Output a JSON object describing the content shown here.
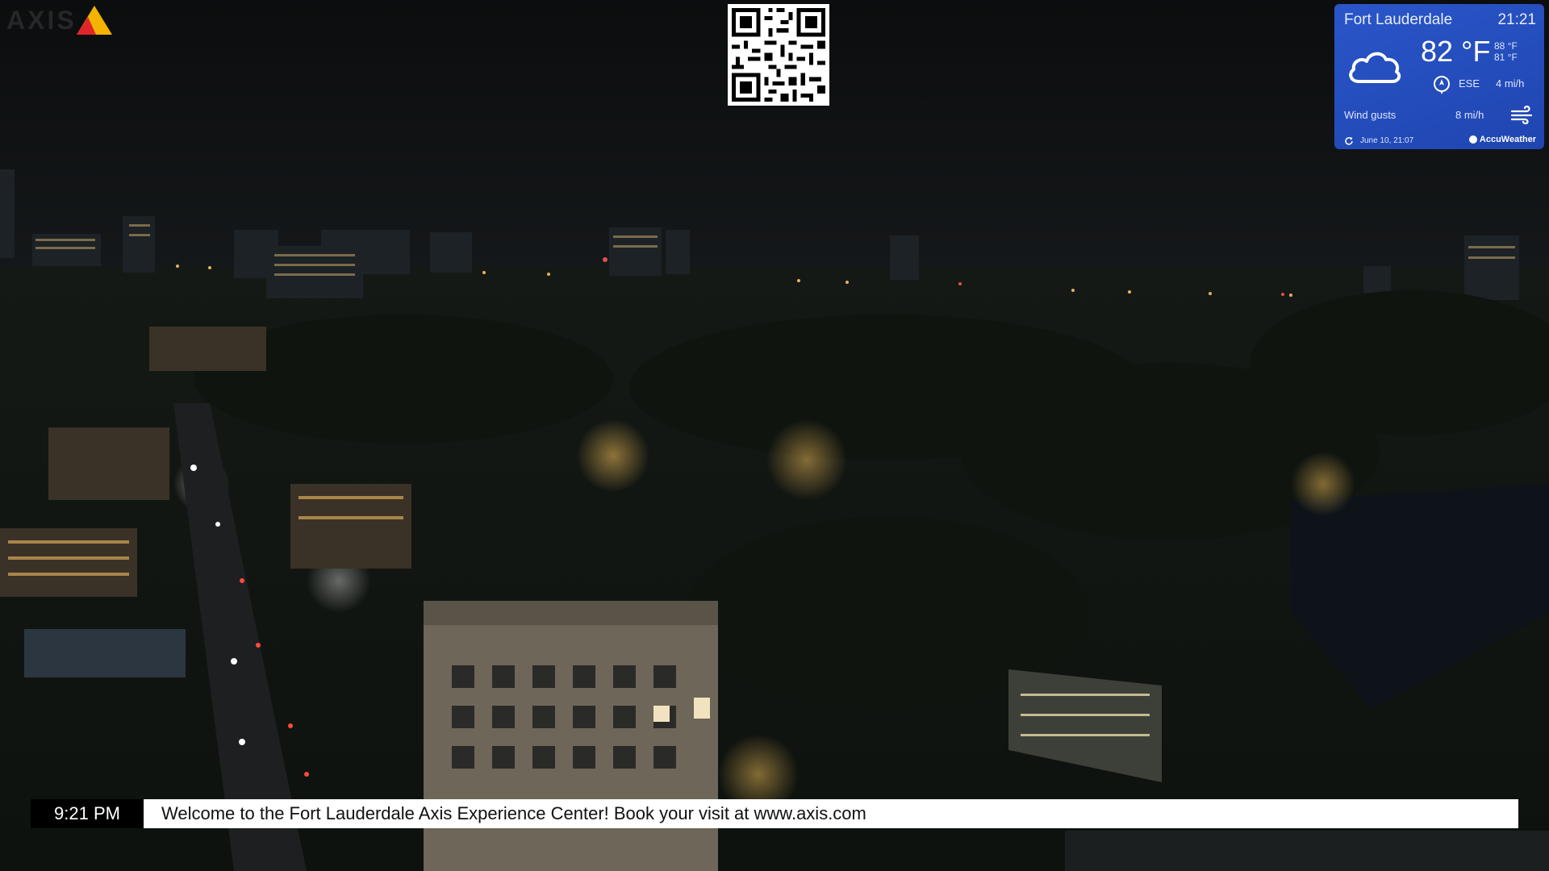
{
  "logo": {
    "text": "AXIS",
    "icon": "axis-triangle-icon"
  },
  "qr_code": {
    "icon": "qr-code-icon"
  },
  "weather": {
    "city": "Fort Lauderdale",
    "time": "21:21",
    "condition_icon": "cloud-icon",
    "temperature": "82 °F",
    "high": "88 °F",
    "low": "81 °F",
    "wind_icon": "wind-direction-icon",
    "wind_direction": "ESE",
    "wind_speed": "4 mi/h",
    "gusts_label": "Wind gusts",
    "gusts_value": "8 mi/h",
    "gusts_icon": "wind-gusts-icon",
    "refresh_icon": "refresh-icon",
    "updated": "June 10, 21:07",
    "provider": "AccuWeather",
    "colors": {
      "panel": "#2a56c9",
      "text": "#ffffff"
    }
  },
  "ticker": {
    "time": "9:21 PM",
    "message": "Welcome to the Fort Lauderdale Axis Experience Center! Book your visit at www.axis.com"
  },
  "scene": {
    "description_icon": "night-city-camera-feed"
  }
}
